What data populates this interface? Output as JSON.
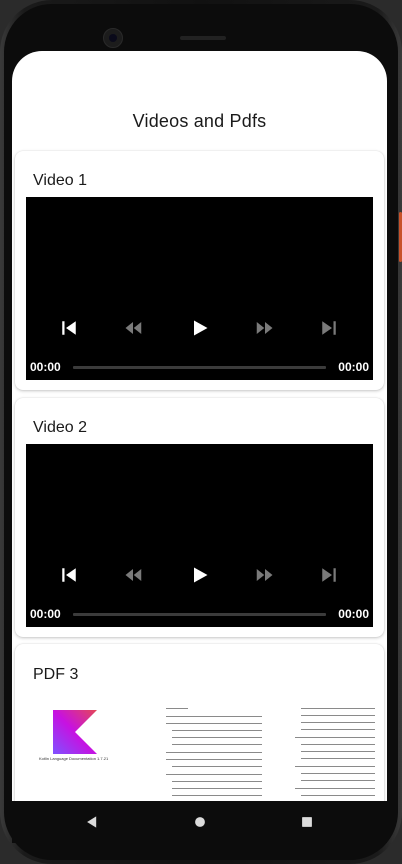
{
  "app_bar": {
    "title": "Videos and Pdfs"
  },
  "cards": [
    {
      "title": "Video 1",
      "player": {
        "position": "00:00",
        "duration": "00:00",
        "progress": 0
      }
    },
    {
      "title": "Video 2",
      "player": {
        "position": "00:00",
        "duration": "00:00",
        "progress": 0
      }
    },
    {
      "title": "PDF 3",
      "pages": [
        {
          "kind": "cover",
          "caption": "Kotlin Language Documentation 1.7.21"
        },
        {
          "kind": "toc"
        },
        {
          "kind": "toc"
        }
      ]
    }
  ],
  "icons": {
    "previous": "skip-previous-icon",
    "rewind": "rewind-icon",
    "play": "play-icon",
    "fast_forward": "fast-forward-icon",
    "next": "skip-next-icon",
    "nav_back": "back-triangle-icon",
    "nav_home": "home-circle-icon",
    "nav_recents": "recents-square-icon"
  },
  "colors": {
    "screen_bg": "#ffffff",
    "player_bg": "#000000",
    "control_active": "#ffffff",
    "control_inactive": "#7a7a7a",
    "timebar": "#3b3b3b"
  }
}
